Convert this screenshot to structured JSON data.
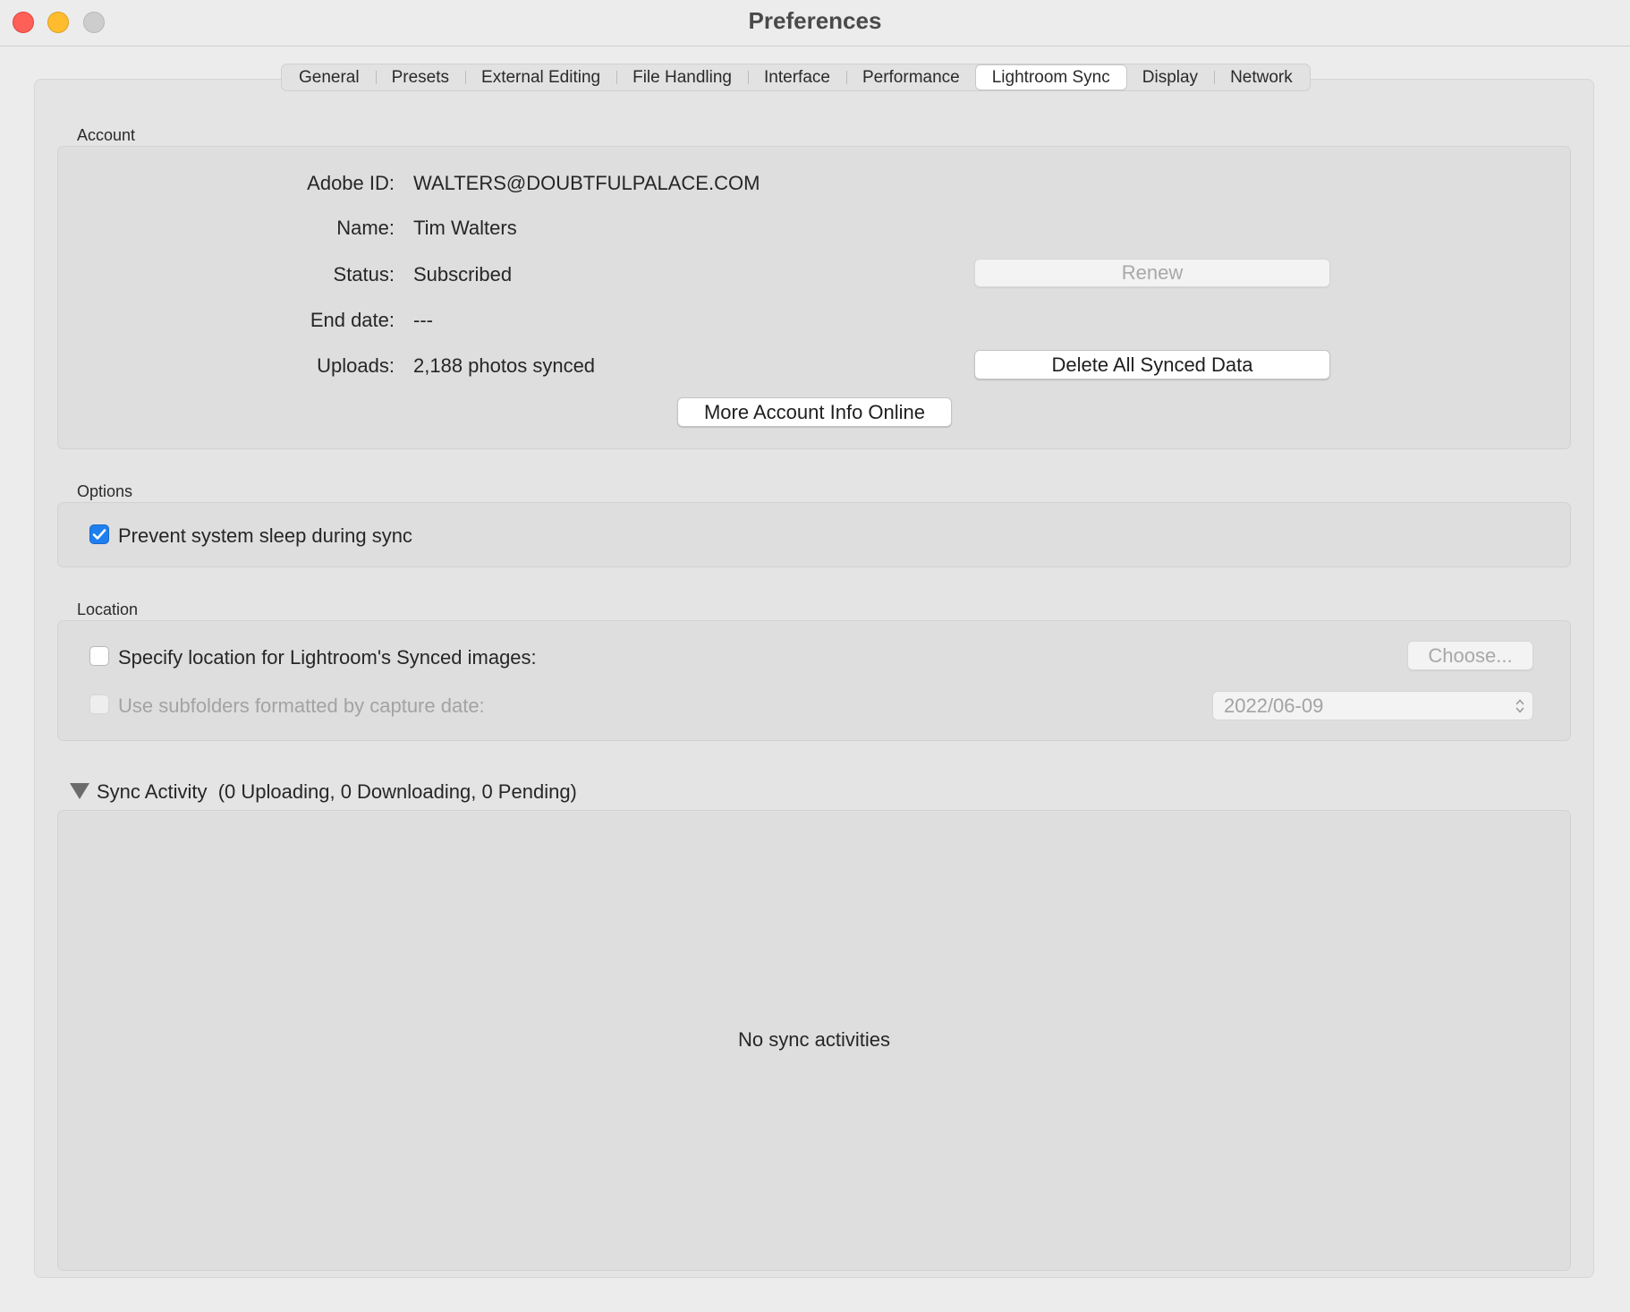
{
  "window": {
    "title": "Preferences"
  },
  "tabs": [
    {
      "label": "General"
    },
    {
      "label": "Presets"
    },
    {
      "label": "External Editing"
    },
    {
      "label": "File Handling"
    },
    {
      "label": "Interface"
    },
    {
      "label": "Performance"
    },
    {
      "label": "Lightroom Sync"
    },
    {
      "label": "Display"
    },
    {
      "label": "Network"
    }
  ],
  "active_tab": "Lightroom Sync",
  "account": {
    "section_label": "Account",
    "adobe_id_label": "Adobe ID:",
    "adobe_id_value": "WALTERS@DOUBTFULPALACE.COM",
    "name_label": "Name:",
    "name_value": "Tim Walters",
    "status_label": "Status:",
    "status_value": "Subscribed",
    "end_date_label": "End date:",
    "end_date_value": "---",
    "uploads_label": "Uploads:",
    "uploads_value": "2,188 photos synced",
    "renew_button": "Renew",
    "delete_button": "Delete All Synced Data",
    "more_info_button": "More Account Info Online"
  },
  "options": {
    "section_label": "Options",
    "prevent_sleep_label": "Prevent system sleep during sync",
    "prevent_sleep_checked": true
  },
  "location": {
    "section_label": "Location",
    "specify_label": "Specify location for Lightroom's Synced images:",
    "specify_checked": false,
    "choose_button": "Choose...",
    "subfolders_label": "Use subfolders formatted by capture date:",
    "subfolders_checked": false,
    "date_format_value": "2022/06-09"
  },
  "sync_activity": {
    "title": "Sync Activity",
    "summary": "(0 Uploading, 0 Downloading, 0 Pending)",
    "empty_message": "No sync activities"
  },
  "colors": {
    "accent": "#1f7ff0",
    "close": "#fe5f57",
    "minimize": "#febc2e",
    "zoom_disabled": "#cdcdcd"
  }
}
